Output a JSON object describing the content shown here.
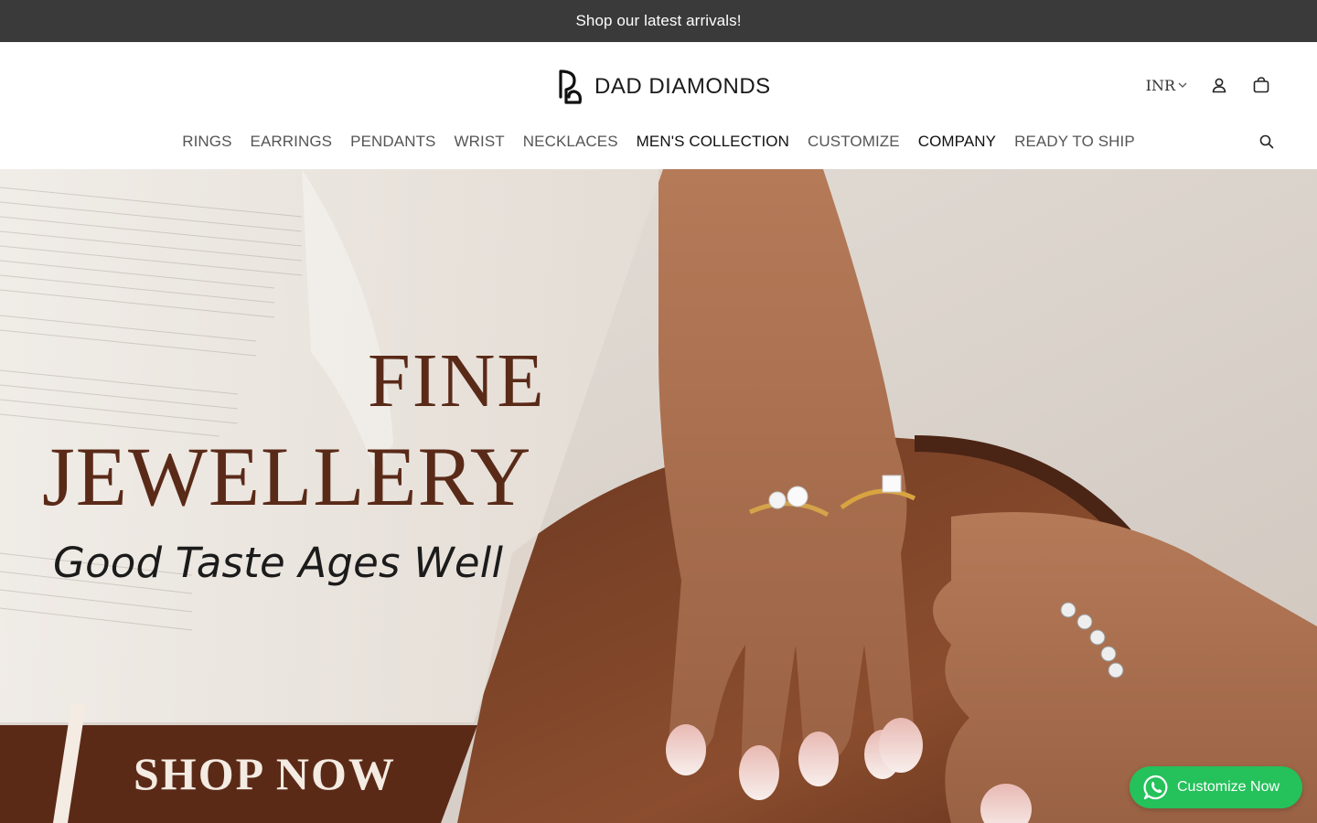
{
  "announcement": {
    "text": "Shop our latest arrivals!"
  },
  "header": {
    "brand": "DAD DIAMONDS",
    "currency": "INR",
    "icons": [
      "account-icon",
      "cart-icon",
      "search-icon"
    ]
  },
  "nav": {
    "items": [
      {
        "label": "RINGS"
      },
      {
        "label": "EARRINGS"
      },
      {
        "label": "PENDANTS"
      },
      {
        "label": "WRIST"
      },
      {
        "label": "NECKLACES"
      },
      {
        "label": "MEN'S COLLECTION"
      },
      {
        "label": "CUSTOMIZE"
      },
      {
        "label": "COMPANY"
      },
      {
        "label": "READY TO SHIP"
      }
    ]
  },
  "hero": {
    "title_line1": "FINE",
    "title_line2": "JEWELLERY",
    "tagline": "Good Taste Ages Well",
    "cta": "SHOP NOW"
  },
  "whatsapp": {
    "label": "Customize Now",
    "color": "#25c15b"
  },
  "colors": {
    "announce_bg": "#3a3a3a",
    "hero_title": "#5a2a18",
    "banner_brown": "#5b2a17"
  }
}
